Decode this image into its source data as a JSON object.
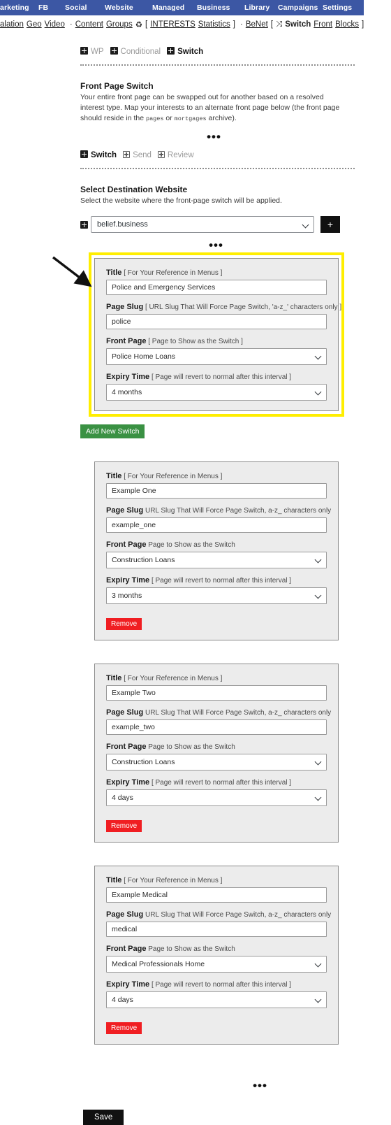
{
  "adminbar": {
    "items": [
      {
        "label": "arketing"
      },
      {
        "label": "FB"
      },
      {
        "label": "Social"
      },
      {
        "label": "Website"
      },
      {
        "label": "Managed"
      },
      {
        "label": "Business"
      },
      {
        "label": "Library"
      },
      {
        "label": "Campaigns"
      },
      {
        "label": "Settings"
      }
    ],
    "background": "#3c57a4"
  },
  "subbar": {
    "items": [
      {
        "label": "alation",
        "style": "link"
      },
      {
        "label": "Geo",
        "style": "link"
      },
      {
        "label": "Video",
        "style": "link"
      },
      {
        "label": "·",
        "style": "dot"
      },
      {
        "label": "Content",
        "style": "link"
      },
      {
        "label": "Groups",
        "style": "link"
      },
      {
        "label": "♻",
        "style": "icon"
      },
      {
        "label": "[",
        "style": "plain"
      },
      {
        "label": "INTERESTS",
        "style": "link"
      },
      {
        "label": "Statistics",
        "style": "link"
      },
      {
        "label": "]",
        "style": "plain"
      },
      {
        "label": "·",
        "style": "dot"
      },
      {
        "label": "BeNet",
        "style": "link"
      },
      {
        "label": "[",
        "style": "plain"
      },
      {
        "label": "⤨",
        "style": "icon"
      },
      {
        "label": "Switch",
        "style": "bold"
      },
      {
        "label": "Front",
        "style": "link"
      },
      {
        "label": "Blocks",
        "style": "link"
      },
      {
        "label": "]",
        "style": "plain"
      }
    ]
  },
  "breadcrumb_tabs": {
    "items": [
      {
        "label": "WP",
        "state": "muted",
        "icon": "plus-square-filled-icon"
      },
      {
        "label": "Conditional",
        "state": "muted",
        "icon": "plus-square-filled-icon"
      },
      {
        "label": "Switch",
        "state": "active",
        "icon": "plus-square-filled-icon"
      }
    ]
  },
  "intro": {
    "title": "Front Page Switch",
    "desc_part1": "Your entire front page can be swapped out for another based on a resolved interest type. Map your interests to an alternate front page below (the front page should reside in the ",
    "mono1": "pages",
    "desc_part2": " or ",
    "mono2": "mortgages",
    "desc_part3": " archive)."
  },
  "ellipsis": "•••",
  "section_tabs": {
    "items": [
      {
        "label": "Switch",
        "state": "active",
        "icon": "plus-square-filled-icon"
      },
      {
        "label": "Send",
        "state": "muted",
        "icon": "plus-square-outline-icon"
      },
      {
        "label": "Review",
        "state": "muted",
        "icon": "plus-square-outline-icon"
      }
    ]
  },
  "destination": {
    "title": "Select Destination Website",
    "desc": "Select the website where the front-page switch will be applied.",
    "selected": "belief.business",
    "options": [
      "belief.business"
    ],
    "add_label": "+"
  },
  "labels": {
    "title": "Title",
    "title_hint_bracket": "[ For Your Reference in Menus ]",
    "page_slug": "Page Slug",
    "page_slug_hint_bracket": "[ URL Slug That Will Force Page Switch, 'a-z_' characters only ]",
    "page_slug_hint_plain": "URL Slug That Will Force Page Switch, a-z_ characters only",
    "front_page": "Front Page",
    "front_page_hint_bracket": "[ Page to Show as the Switch ]",
    "front_page_hint_plain": "Page to Show as the Switch",
    "expiry_time": "Expiry Time",
    "expiry_hint_bracket": "[ Page will revert to normal after this interval ]"
  },
  "buttons": {
    "add_new_switch": "Add New Switch",
    "remove": "Remove",
    "save": "Save"
  },
  "switches": [
    {
      "highlighted": true,
      "title": "Police and Emergency Services",
      "slug": "police",
      "front_page": "Police Home Loans",
      "expiry": "4 months",
      "slug_hint_style": "bracket",
      "front_page_hint_style": "bracket",
      "has_remove": false
    },
    {
      "highlighted": false,
      "title": "Example One",
      "slug": "example_one",
      "front_page": "Construction Loans",
      "expiry": "3 months",
      "slug_hint_style": "plain",
      "front_page_hint_style": "plain",
      "has_remove": true
    },
    {
      "highlighted": false,
      "title": "Example Two",
      "slug": "example_two",
      "front_page": "Construction Loans",
      "expiry": "4 days",
      "slug_hint_style": "plain",
      "front_page_hint_style": "plain",
      "has_remove": true
    },
    {
      "highlighted": false,
      "title": "Example Medical",
      "slug": "medical",
      "front_page": "Medical Professionals Home",
      "expiry": "4 days",
      "slug_hint_style": "plain",
      "front_page_hint_style": "plain",
      "has_remove": true
    }
  ],
  "colors": {
    "nav_blue": "#3c57a4",
    "highlight_yellow": "#ffee00",
    "add_green": "#3a9143",
    "remove_red": "#f01e22",
    "save_black": "#111111"
  }
}
